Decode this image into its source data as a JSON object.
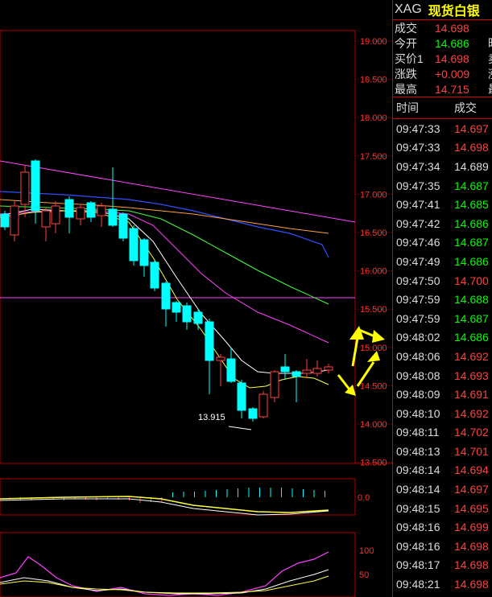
{
  "quote": {
    "code": "XAG",
    "name": "现货白银",
    "rows": [
      {
        "label": "成交",
        "value": "14.698",
        "color": "#ff4040",
        "extra": ""
      },
      {
        "label": "今开",
        "value": "14.686",
        "color": "#00ff00",
        "extra": "昨"
      },
      {
        "label": "买价1",
        "value": "14.698",
        "color": "#ff4040",
        "extra": "卖"
      },
      {
        "label": "涨跌",
        "value": "+0.009",
        "color": "#ff4040",
        "extra": "涨"
      },
      {
        "label": "最高",
        "value": "14.715",
        "color": "#ff4040",
        "extra": "最"
      }
    ]
  },
  "ticks": {
    "header_time": "时间",
    "header_price": "成交",
    "rows": [
      {
        "time": "09:47:33",
        "price": "14.697",
        "color": "red"
      },
      {
        "time": "09:47:33",
        "price": "14.698",
        "color": "red"
      },
      {
        "time": "09:47:34",
        "price": "14.689",
        "color": "white"
      },
      {
        "time": "09:47:35",
        "price": "14.687",
        "color": "green"
      },
      {
        "time": "09:47:41",
        "price": "14.685",
        "color": "green"
      },
      {
        "time": "09:47:42",
        "price": "14.686",
        "color": "green"
      },
      {
        "time": "09:47:46",
        "price": "14.687",
        "color": "green"
      },
      {
        "time": "09:47:49",
        "price": "14.686",
        "color": "green"
      },
      {
        "time": "09:47:50",
        "price": "14.700",
        "color": "red"
      },
      {
        "time": "09:47:59",
        "price": "14.688",
        "color": "green"
      },
      {
        "time": "09:47:59",
        "price": "14.687",
        "color": "green"
      },
      {
        "time": "09:48:02",
        "price": "14.686",
        "color": "green"
      },
      {
        "time": "09:48:06",
        "price": "14.692",
        "color": "red"
      },
      {
        "time": "09:48:08",
        "price": "14.693",
        "color": "red"
      },
      {
        "time": "09:48:09",
        "price": "14.691",
        "color": "red"
      },
      {
        "time": "09:48:10",
        "price": "14.692",
        "color": "red"
      },
      {
        "time": "09:48:11",
        "price": "14.702",
        "color": "red"
      },
      {
        "time": "09:48:13",
        "price": "14.701",
        "color": "red"
      },
      {
        "time": "09:48:14",
        "price": "14.694",
        "color": "red"
      },
      {
        "time": "09:48:14",
        "price": "14.697",
        "color": "red"
      },
      {
        "time": "09:48:15",
        "price": "14.695",
        "color": "red"
      },
      {
        "time": "09:48:16",
        "price": "14.699",
        "color": "red"
      },
      {
        "time": "09:48:16",
        "price": "14.698",
        "color": "red"
      },
      {
        "time": "09:48:17",
        "price": "14.698",
        "color": "red"
      },
      {
        "time": "09:48:21",
        "price": "14.698",
        "color": "red"
      }
    ]
  },
  "chart": {
    "price_axis": [
      "19.000",
      "18.500",
      "18.000",
      "17.500",
      "17.000",
      "16.500",
      "16.000",
      "15.500",
      "15.000",
      "14.500",
      "14.000",
      "13.500"
    ],
    "low_label": "13.915",
    "macd_axis": "0.0",
    "kdj_axis": [
      "100",
      "50"
    ]
  }
}
